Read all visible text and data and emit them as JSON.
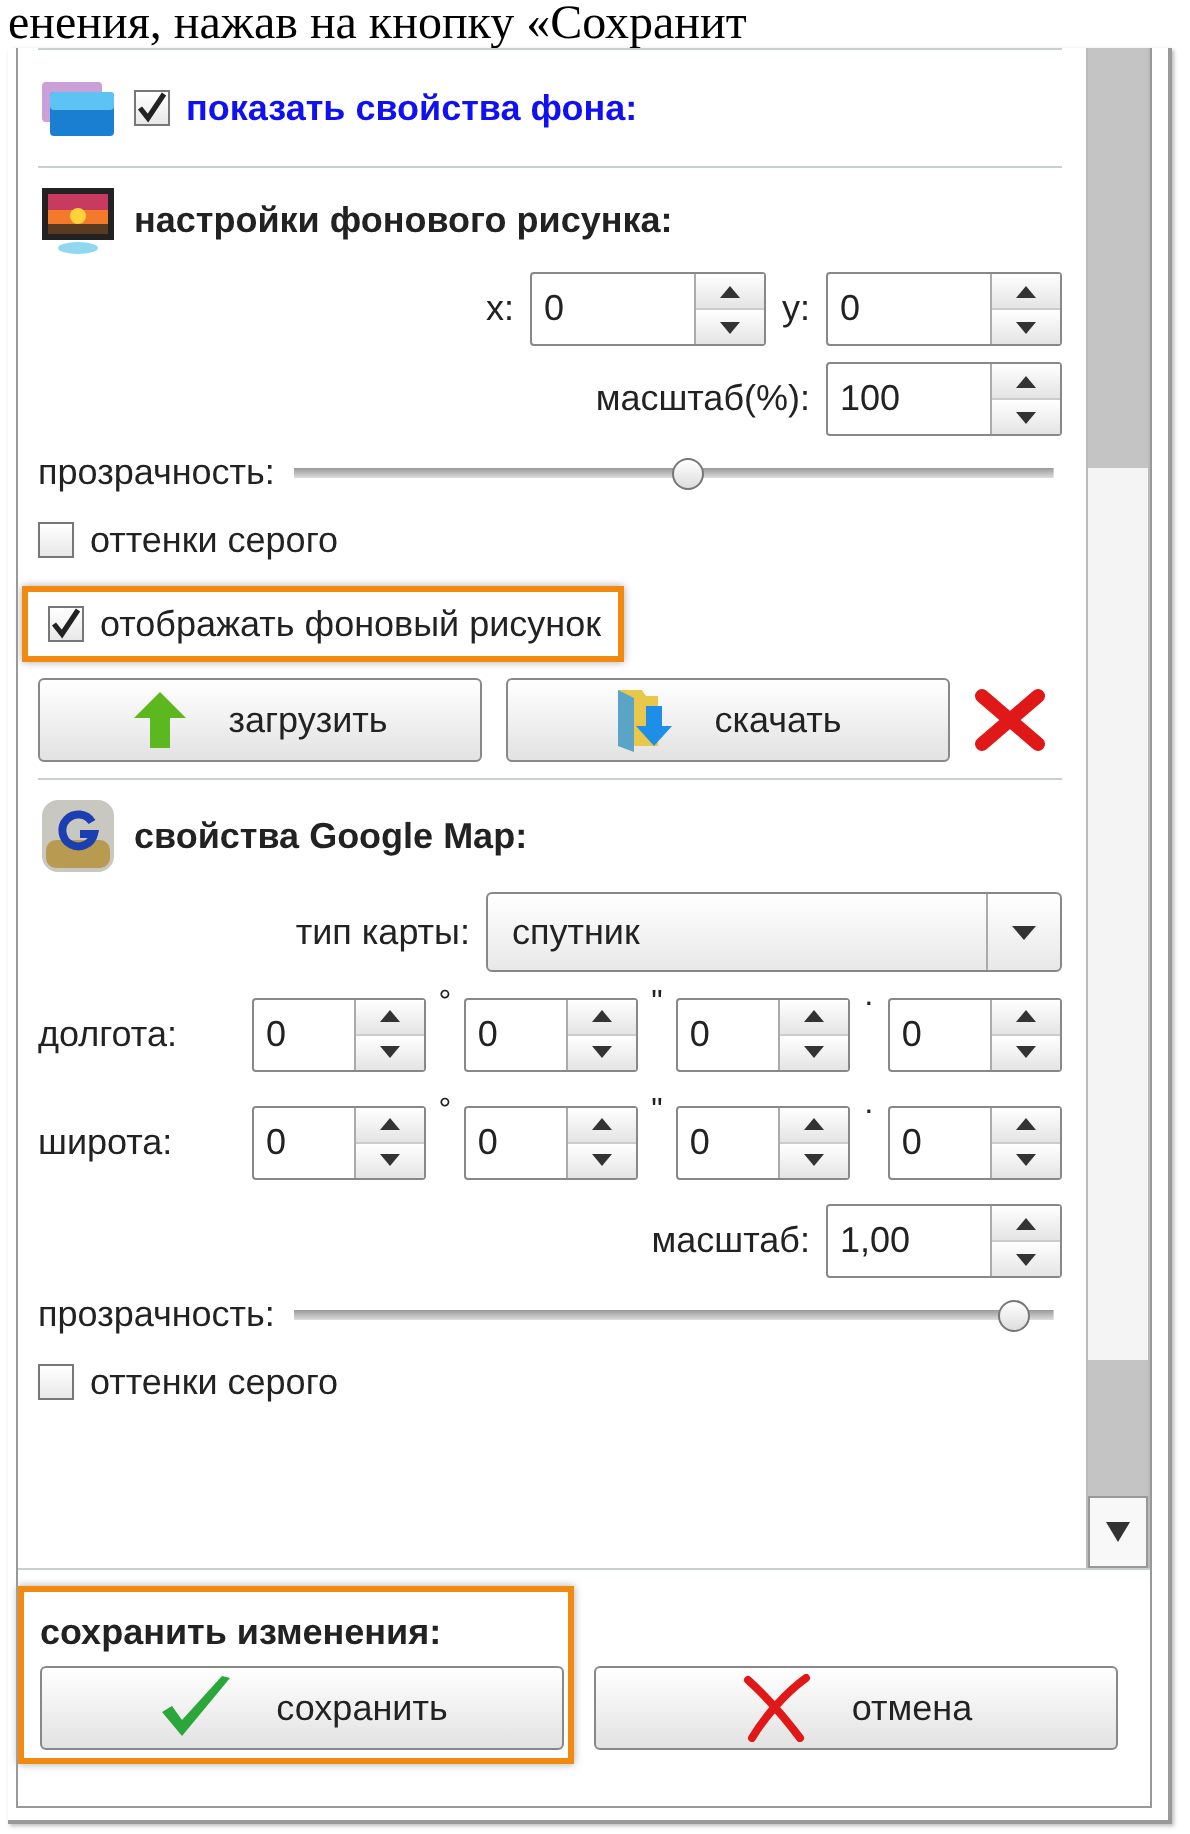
{
  "caption_text": "енения, нажав на кнопку «Сохранит",
  "background_properties": {
    "label": "показать свойства фона:",
    "checked": true
  },
  "image_settings": {
    "title": "настройки фонового рисунка:",
    "x": {
      "label": "x:",
      "value": "0"
    },
    "y": {
      "label": "y:",
      "value": "0"
    },
    "scale": {
      "label": "масштаб(%):",
      "value": "100"
    },
    "opacity": {
      "label": "прозрачность:",
      "level": 0.52
    },
    "checkboxes": [
      {
        "label": "оттенки серого",
        "checked": false,
        "highlighted": false
      },
      {
        "label": "отображать фоновый рисунок",
        "checked": true,
        "highlighted": true
      }
    ],
    "buttons": [
      {
        "label": "загрузить",
        "kind": "upload"
      },
      {
        "label": "скачать",
        "kind": "download"
      }
    ]
  },
  "map_settings": {
    "title": "свойства Google Map:",
    "map_type": {
      "label": "тип карты:",
      "value": "спутник"
    },
    "separators": [
      "°",
      "\"",
      "·"
    ],
    "coordinates": [
      {
        "label": "долгота:",
        "values": [
          "0",
          "0",
          "0",
          "0"
        ]
      },
      {
        "label": "широта:",
        "values": [
          "0",
          "0",
          "0",
          "0"
        ]
      }
    ],
    "scale": {
      "label": "масштаб:",
      "value": "1,00"
    },
    "opacity": {
      "label": "прозрачность:",
      "level": 0.97
    },
    "checkboxes": [
      {
        "label": "оттенки серого",
        "checked": false,
        "highlighted": false
      }
    ]
  },
  "save_section": {
    "title": "сохранить изменения:",
    "highlighted": true,
    "buttons": [
      {
        "label": "сохранить",
        "kind": "save"
      },
      {
        "label": "отмена",
        "kind": "cancel"
      }
    ]
  }
}
